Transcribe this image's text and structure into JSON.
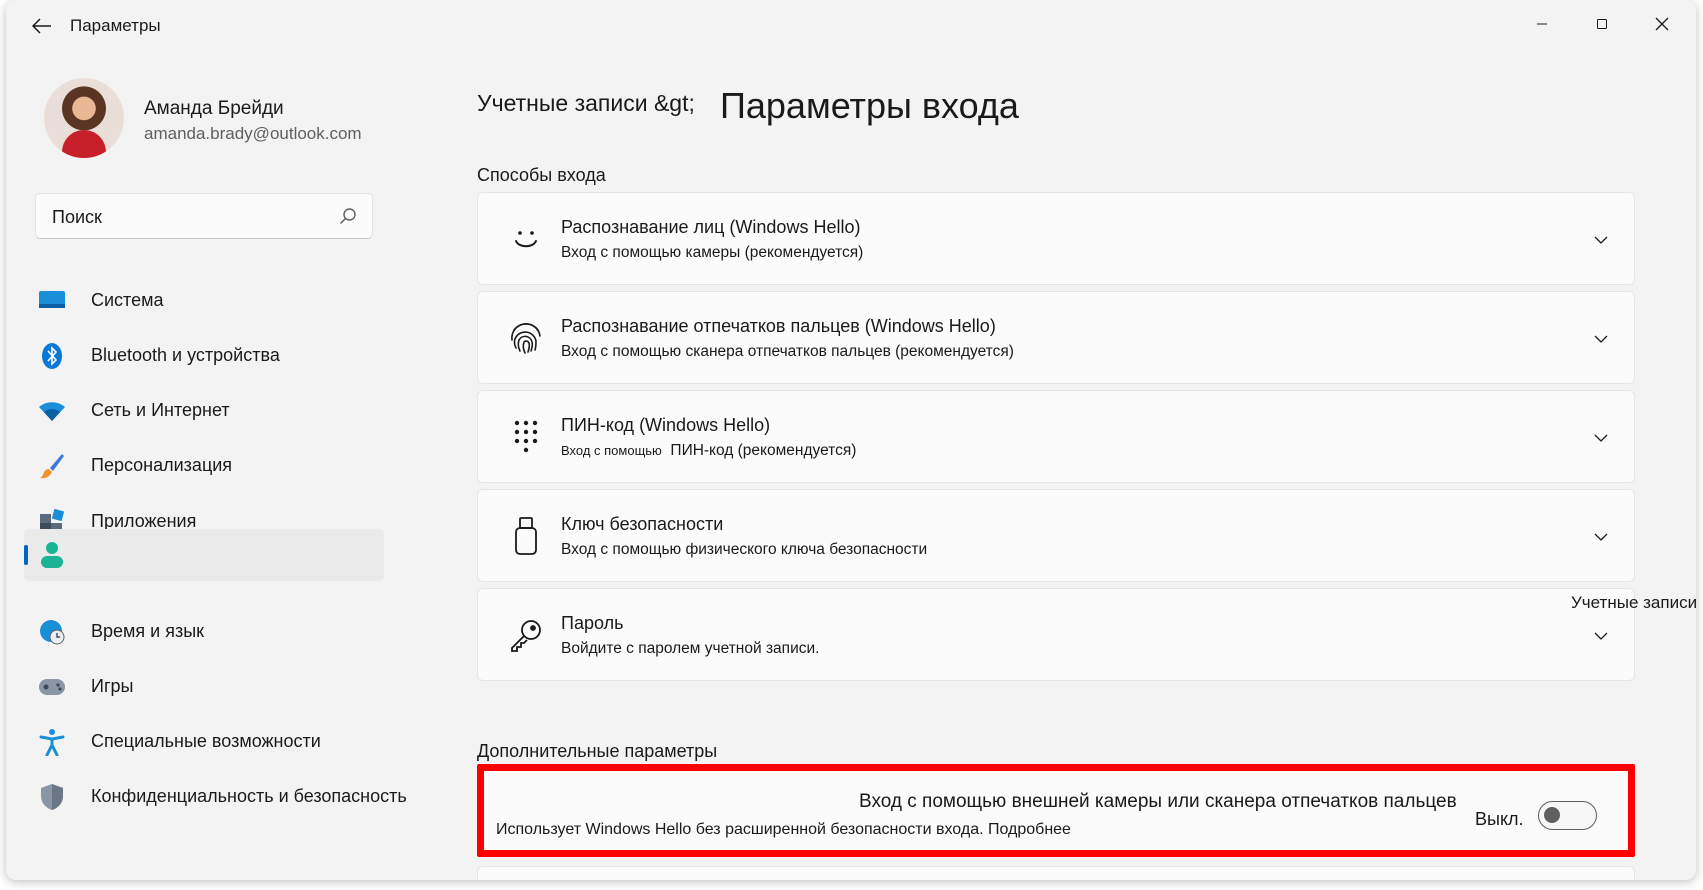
{
  "window": {
    "title": "Параметры"
  },
  "profile": {
    "name": "Аманда Брейди",
    "email": "amanda.brady@outlook.com"
  },
  "search": {
    "placeholder": "Поиск"
  },
  "nav": {
    "items": [
      {
        "label": "Система",
        "icon": "monitor-icon"
      },
      {
        "label": "Bluetooth и устройства",
        "icon": "bluetooth-icon"
      },
      {
        "label": "Сеть и Интернет",
        "icon": "wifi-icon"
      },
      {
        "label": "Персонализация",
        "icon": "brush-icon"
      },
      {
        "label": "Приложения",
        "icon": "apps-icon"
      },
      {
        "label": "",
        "icon": "person-icon",
        "selected": true
      },
      {
        "label": "Время и язык",
        "icon": "clock-globe-icon"
      },
      {
        "label": "Игры",
        "icon": "gamepad-icon"
      },
      {
        "label": "Специальные возможности",
        "icon": "accessibility-icon"
      },
      {
        "label": "Конфиденциальность и безопасность",
        "icon": "shield-icon"
      }
    ]
  },
  "breadcrumb": {
    "parent": "Учетные записи &gt;",
    "current": "Параметры входа"
  },
  "sign_in_options": {
    "title": "Способы входа",
    "items": [
      {
        "title": "Распознавание лиц (Windows Hello)",
        "subtitle": "Вход с помощью камеры (рекомендуется)",
        "icon": "face-icon"
      },
      {
        "title": "Распознавание отпечатков пальцев (Windows Hello)",
        "subtitle": "Вход с помощью сканера отпечатков пальцев (рекомендуется)",
        "icon": "fingerprint-icon"
      },
      {
        "title": "ПИН-код (Windows Hello)",
        "subtitle_small": "Вход с помощью",
        "subtitle": "ПИН-код (рекомендуется)",
        "icon": "keypad-icon"
      },
      {
        "title": "Ключ безопасности",
        "subtitle": "Вход с помощью физического ключа безопасности",
        "icon": "usb-key-icon"
      },
      {
        "title": "Пароль",
        "subtitle": "Войдите с паролем учетной записи.",
        "icon": "key-icon"
      }
    ]
  },
  "overflow_label": "Учетные записи",
  "additional": {
    "title": "Дополнительные параметры",
    "external_title": "Вход с помощью внешней камеры или сканера отпечатков пальцев",
    "external_sub": "Использует Windows Hello без расширенной безопасности входа. Подробнее",
    "toggle_label": "Выкл.",
    "toggle_on": false
  },
  "colors": {
    "accent": "#0067c0",
    "highlight": "#ff0000"
  }
}
